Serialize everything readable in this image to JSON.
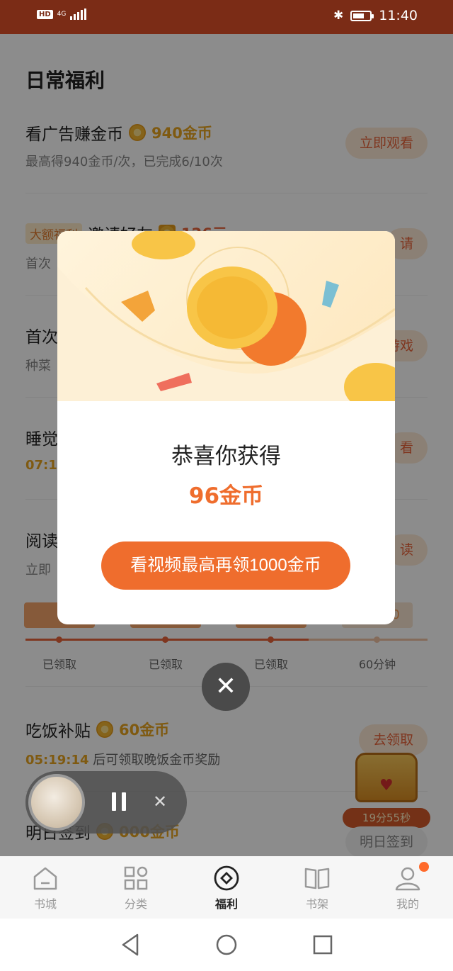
{
  "status_bar": {
    "hd": "HD",
    "network": "4G",
    "time": "11:40",
    "battery_level": 0.7
  },
  "page": {
    "section_title": "日常福利",
    "tasks": [
      {
        "title": "看广告赚金币",
        "reward": "940金币",
        "subtitle": "最高得940金币/次，已完成6/10次",
        "button": "立即观看"
      },
      {
        "tag": "大额福利",
        "title": "邀请好友",
        "reward": "126元",
        "subtitle": "首次",
        "button": "请"
      },
      {
        "title": "首次",
        "subtitle": "种菜",
        "button": "游戏"
      },
      {
        "title": "睡觉",
        "subtitle": "07:1",
        "button": "看"
      },
      {
        "title": "阅读",
        "subtitle": "立即",
        "button": "读"
      }
    ],
    "progress": {
      "labels": [
        "已领取",
        "已领取",
        "已领取",
        "60分钟"
      ],
      "last_badge": "0"
    },
    "meal_task": {
      "title": "吃饭补贴",
      "reward": "60金币",
      "countdown": "05:19:14",
      "subtitle_suffix": " 后可领取晚饭金币奖励",
      "button": "去领取"
    },
    "signin_task": {
      "title": "明日签到",
      "reward": "000金币",
      "chest_timer": "19分55秒",
      "button": "明日签到"
    }
  },
  "modal": {
    "title": "恭喜你获得",
    "reward": "96金币",
    "cta": "看视频最高再领1000金币"
  },
  "tabbar": {
    "tabs": [
      {
        "label": "书城",
        "icon": "bookstore-icon"
      },
      {
        "label": "分类",
        "icon": "category-icon"
      },
      {
        "label": "福利",
        "icon": "welfare-icon",
        "active": true
      },
      {
        "label": "书架",
        "icon": "bookshelf-icon"
      },
      {
        "label": "我的",
        "icon": "profile-icon",
        "badge": true
      }
    ]
  },
  "colors": {
    "status_bar": "#7b2c16",
    "accent": "#ef6d2d",
    "gold": "#e8a520"
  }
}
